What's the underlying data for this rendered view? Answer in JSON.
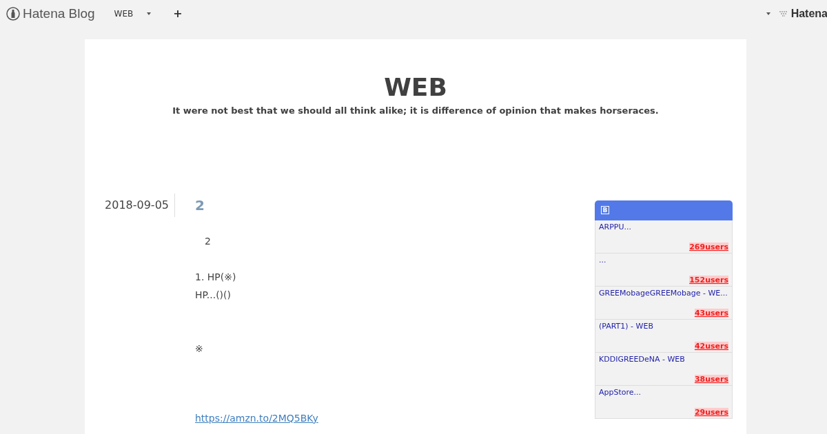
{
  "topbar": {
    "logo": "Hatena Blog",
    "blog_name": "WEB",
    "add": "+",
    "right_logo": "Hatena"
  },
  "blog": {
    "title": "WEB",
    "tagline": "It were not best that we should all think alike; it is difference of opinion that makes horseraces."
  },
  "entry": {
    "date": "2018-09-05",
    "title": "2",
    "paragraphs": [
      {
        "kind": "text",
        "text": "　2"
      },
      {
        "kind": "gap"
      },
      {
        "kind": "text",
        "text": "1. HP(※)"
      },
      {
        "kind": "text",
        "text": "HP...()()"
      },
      {
        "kind": "gap"
      },
      {
        "kind": "gap"
      },
      {
        "kind": "text",
        "text": "※"
      },
      {
        "kind": "gap"
      },
      {
        "kind": "gap"
      },
      {
        "kind": "gap"
      },
      {
        "kind": "link",
        "text": "https://amzn.to/2MQ5BKy"
      }
    ]
  },
  "bookmarks": {
    "header_icon": "B",
    "items": [
      {
        "title": "ARPPU...",
        "users": "269users"
      },
      {
        "title": "...",
        "users": "152users"
      },
      {
        "title": "GREEMobageGREEMobage - WE...",
        "users": "43users"
      },
      {
        "title": "(PART1) - WEB",
        "users": "42users"
      },
      {
        "title": "KDDIGREEDeNA - WEB",
        "users": "38users"
      },
      {
        "title": "AppStore...",
        "users": "29users"
      }
    ]
  }
}
